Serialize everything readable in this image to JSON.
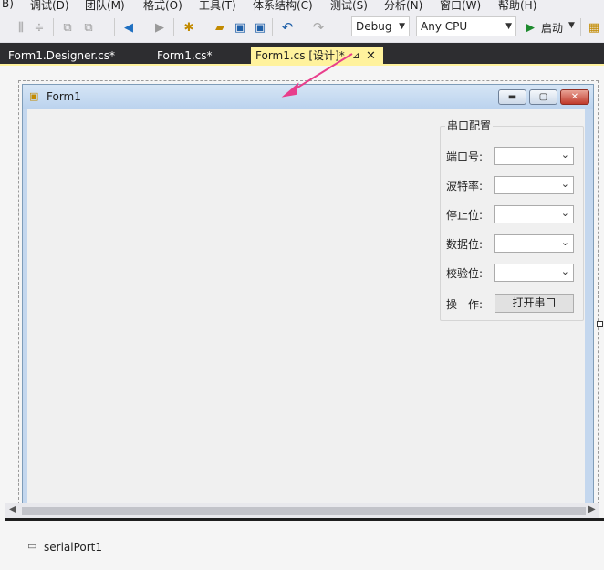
{
  "menu": {
    "items": [
      "B)",
      "调试(D)",
      "团队(M)",
      "格式(O)",
      "工具(T)",
      "体系结构(C)",
      "测试(S)",
      "分析(N)",
      "窗口(W)",
      "帮助(H)"
    ]
  },
  "toolbar": {
    "config": "Debug",
    "platform": "Any CPU",
    "start_label": "启动",
    "icons": [
      "align-icon",
      "back-icon",
      "forward-icon",
      "new-item-icon",
      "open-icon",
      "save-icon",
      "save-all-icon",
      "undo-icon",
      "redo-icon",
      "start-icon"
    ]
  },
  "tabs": [
    {
      "label": "Form1.Designer.cs*"
    },
    {
      "label": "Form1.cs*"
    },
    {
      "label": "Form1.cs [设计]*"
    }
  ],
  "form": {
    "title": "Form1",
    "group_title": "串口配置",
    "fields": [
      {
        "label": "端口号:"
      },
      {
        "label": "波特率:"
      },
      {
        "label": "停止位:"
      },
      {
        "label": "数据位:"
      },
      {
        "label": "校验位:"
      }
    ],
    "action_label": "操　作:",
    "open_button": "打开串口"
  },
  "tray": {
    "component": "serialPort1"
  },
  "colors": {
    "accent_tab": "#fff29d",
    "tab_bar": "#2d2d30",
    "arrow": "#e83e8c"
  }
}
